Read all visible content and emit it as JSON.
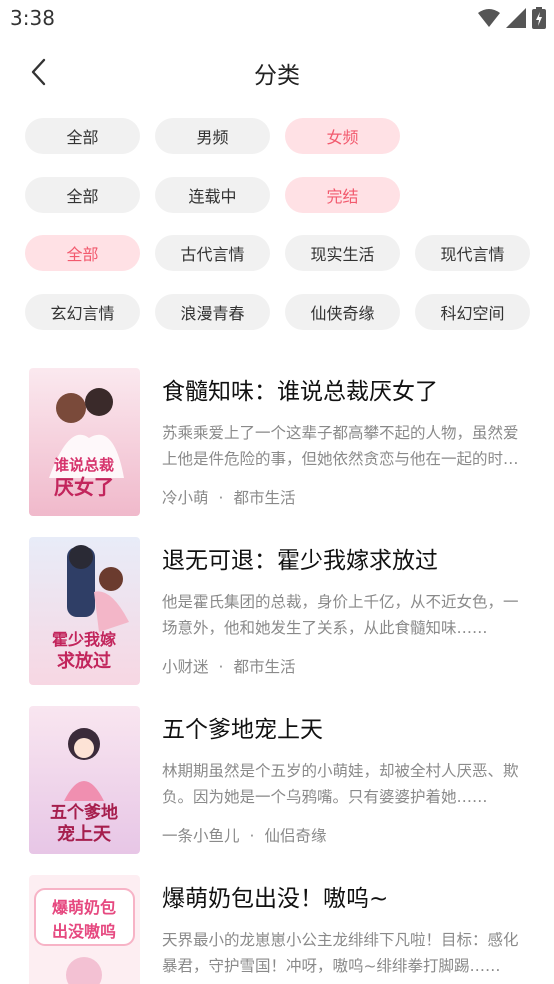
{
  "status": {
    "time": "3:38"
  },
  "header": {
    "title": "分类"
  },
  "filters": {
    "gender": [
      "全部",
      "男频",
      "女频"
    ],
    "status": [
      "全部",
      "连载中",
      "完结"
    ],
    "genre_row1": [
      "全部",
      "古代言情",
      "现实生活",
      "现代言情"
    ],
    "genre_row2": [
      "玄幻言情",
      "浪漫青春",
      "仙侠奇缘",
      "科幻空间"
    ]
  },
  "books": [
    {
      "title": "食髓知味：谁说总裁厌女了",
      "desc": "苏乘乘爱上了一个这辈子都高攀不起的人物，虽然爱上他是件危险的事，但她依然贪恋与他在一起的时光……",
      "author": "冷小萌",
      "category": "都市生活",
      "cover_text": "谁说总裁厌女了",
      "cover_color": "#f6d3de"
    },
    {
      "title": "退无可退：霍少我嫁求放过",
      "desc": "他是霍氏集团的总裁，身价上千亿，从不近女色，一场意外，他和她发生了关系，从此食髓知味……",
      "author": "小财迷",
      "category": "都市生活",
      "cover_text": "霍少我嫁求放过",
      "cover_color": "#dfe4f2"
    },
    {
      "title": "五个爹地宠上天",
      "desc": "林期期虽然是个五岁的小萌娃，却被全村人厌恶、欺负。因为她是一个乌鸦嘴。只有婆婆护着她……",
      "author": "一条小鱼儿",
      "category": "仙侣奇缘",
      "cover_text": "五个爹地宠上天",
      "cover_color": "#f4d7e8"
    },
    {
      "title": "爆萌奶包出没！嗷呜~",
      "desc": "天界最小的龙崽崽小公主龙绯绯下凡啦！目标：感化暴君，守护雪国！冲呀，嗷呜~绯绯拳打脚踢……",
      "author": "",
      "category": "",
      "cover_text": "爆萌奶包出没嗷呜",
      "cover_color": "#fbe3ea"
    }
  ],
  "colors": {
    "accent": "#f25a6e",
    "chip_active_bg": "#ffe1e5",
    "chip_bg": "#f1f1f1"
  },
  "icons": {
    "back": "chevron-left-icon",
    "wifi": "wifi-icon",
    "signal": "signal-icon",
    "battery": "battery-icon"
  }
}
